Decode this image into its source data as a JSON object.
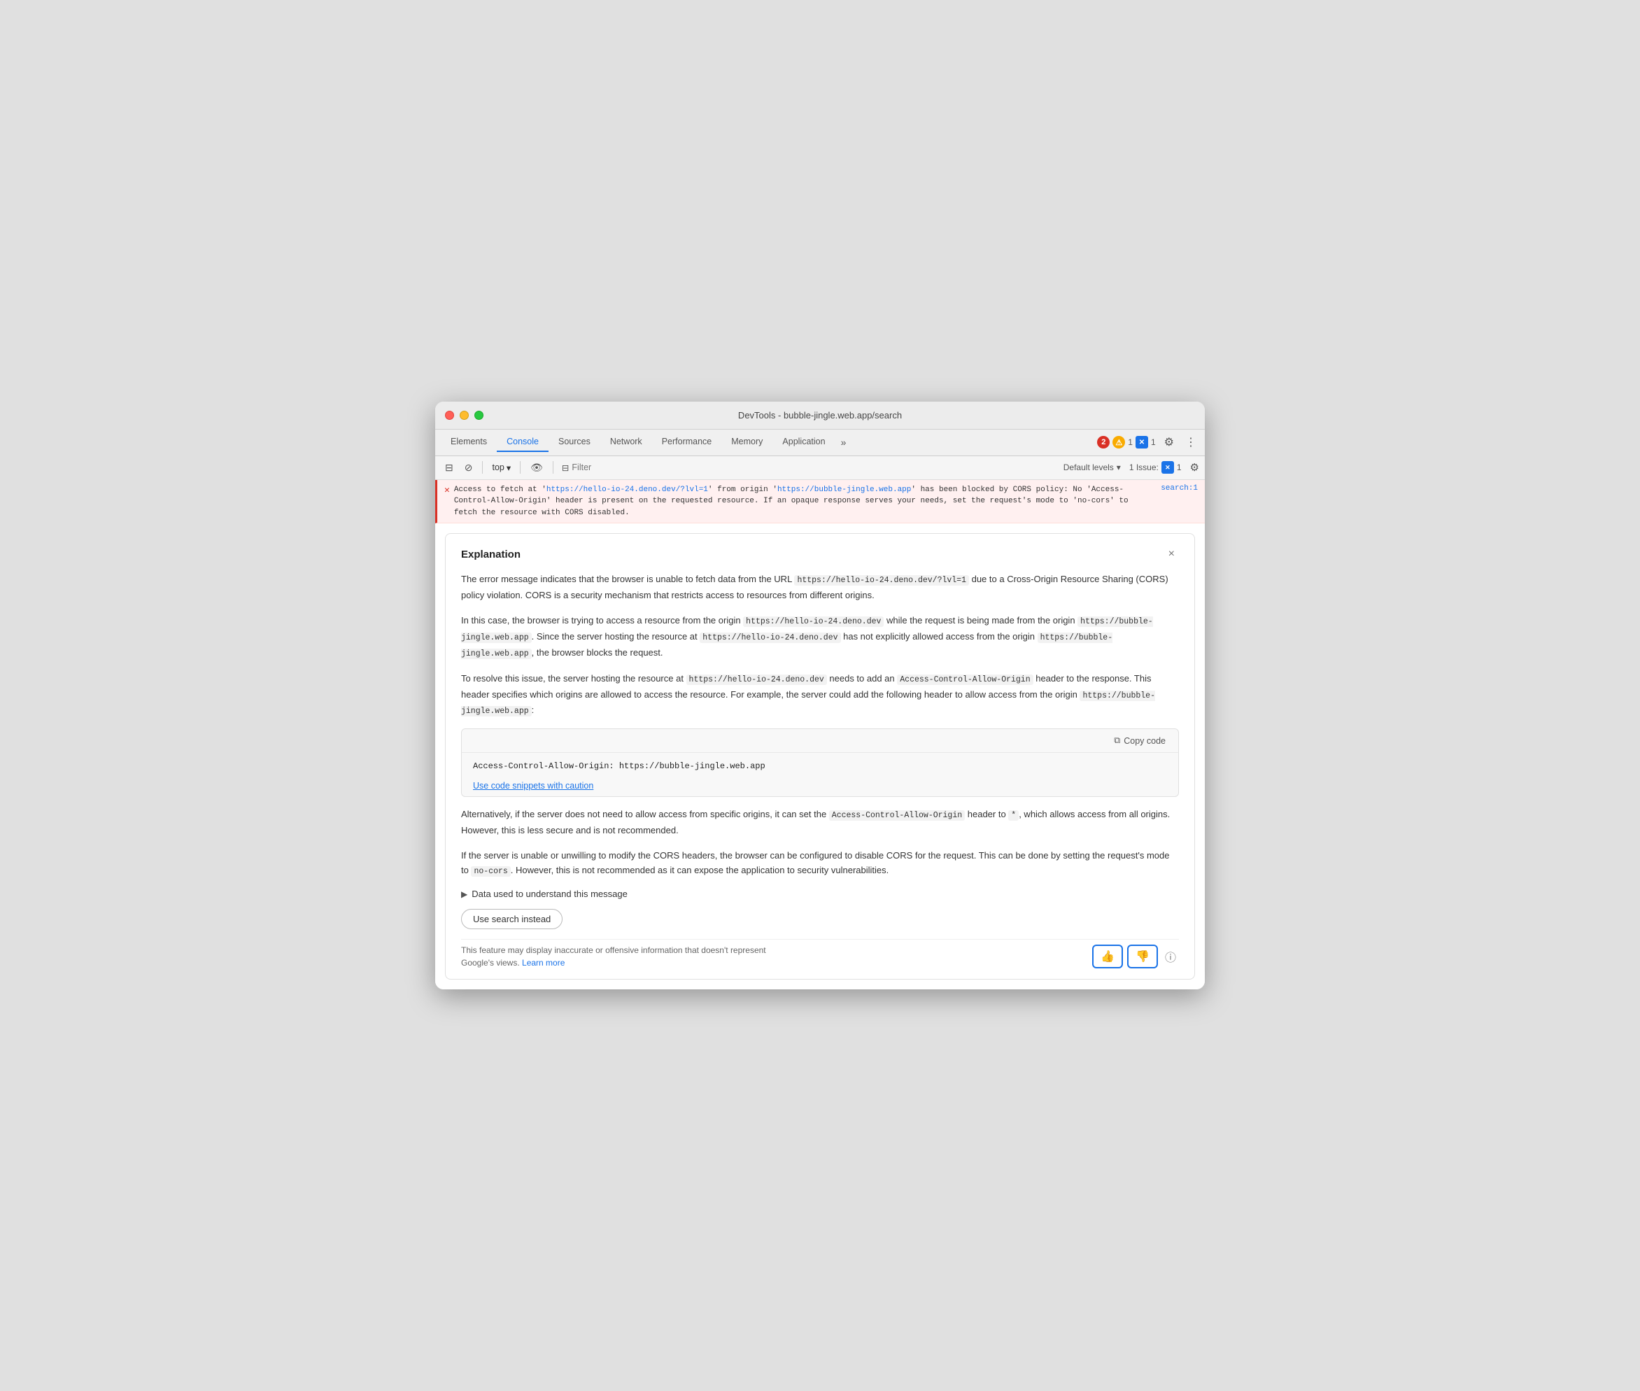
{
  "window": {
    "title": "DevTools - bubble-jingle.web.app/search"
  },
  "tabs": {
    "items": [
      {
        "label": "Elements",
        "active": false
      },
      {
        "label": "Console",
        "active": true
      },
      {
        "label": "Sources",
        "active": false
      },
      {
        "label": "Network",
        "active": false
      },
      {
        "label": "Performance",
        "active": false
      },
      {
        "label": "Memory",
        "active": false
      },
      {
        "label": "Application",
        "active": false
      }
    ],
    "more_label": "»",
    "error_count": "2",
    "warn_count": "1",
    "info_count": "1"
  },
  "toolbar": {
    "context": "top",
    "filter_placeholder": "Filter",
    "filter_label": "Filter",
    "levels_label": "Default levels",
    "issue_label": "1 Issue:",
    "issue_count": "1"
  },
  "console_error": {
    "icon": "✕",
    "message_before": "Access to fetch at '",
    "url1": "https://hello-io-24.deno.dev/?lvl=1",
    "message_mid1": "' from origin '",
    "url2": "https://bubble-jingle.web.app",
    "message_after": "' has been blocked by CORS policy: No 'Access-Control-Allow-Origin' header is present on the requested resource. If an opaque response serves your needs, set the request's mode to 'no-cors' to fetch the resource with CORS disabled.",
    "source_link": "search:1"
  },
  "explanation": {
    "title": "Explanation",
    "close_label": "×",
    "para1": "The error message indicates that the browser is unable to fetch data from the URL",
    "url_inline": "https://hello-io-24.deno.dev/?lvl=1",
    "para1_cont": "due to a Cross-Origin Resource Sharing (CORS) policy violation. CORS is a security mechanism that restricts access to resources from different origins.",
    "para2_before": "In this case, the browser is trying to access a resource from the origin",
    "origin1": "https://hello-io-24.deno.dev",
    "para2_mid": "while the request is being made from the origin",
    "origin2": "https://bubble-jingle.web.app",
    "para2_mid2": ". Since the server hosting the resource at",
    "origin3": "https://hello-io-24.deno.dev",
    "para2_mid3": "has not explicitly allowed access from the origin",
    "origin4": "https://bubble-jingle.web.app",
    "para2_end": ", the browser blocks the request.",
    "para3_before": "To resolve this issue, the server hosting the resource at",
    "para3_origin": "https://hello-io-24.deno.dev",
    "para3_mid": "needs to add an",
    "para3_code": "Access-Control-Allow-Origin",
    "para3_cont": "header to the response. This header specifies which origins are allowed to access the resource. For example, the server could add the following header to allow access from the origin",
    "para3_origin2": "https://bubble-jingle.web.app",
    "para3_end": ":",
    "copy_label": "Copy code",
    "code_snippet": "Access-Control-Allow-Origin: https://bubble-jingle.web.app",
    "caution_label": "Use code snippets with caution",
    "para4_before": "Alternatively, if the server does not need to allow access from specific origins, it can set the",
    "para4_code": "Access-Control-Allow-Origin",
    "para4_mid": "header to",
    "para4_star": "*",
    "para4_end": ", which allows access from all origins. However, this is less secure and is not recommended.",
    "para5_before": "If the server is unable or unwilling to modify the CORS headers, the browser can be configured to disable CORS for the request. This can be done by setting the request's mode to",
    "para5_code": "no-cors",
    "para5_end": ". However, this is not recommended as it can expose the application to security vulnerabilities.",
    "data_used_label": "Data used to understand this message",
    "use_search_label": "Use search instead",
    "disclaimer_text": "This feature may display inaccurate or offensive information that doesn't represent Google's views.",
    "learn_more_label": "Learn more"
  }
}
